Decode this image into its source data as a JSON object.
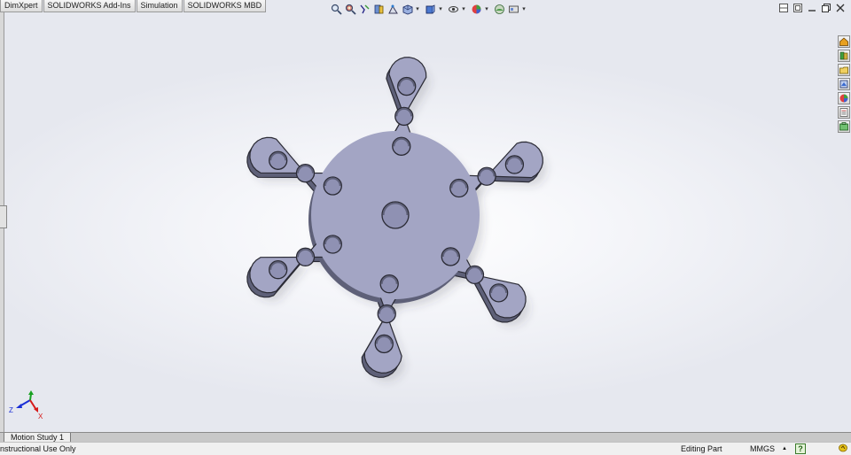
{
  "command_tabs": [
    "DimXpert",
    "SOLIDWORKS Add-Ins",
    "Simulation",
    "SOLIDWORKS MBD"
  ],
  "heads_up_toolbar": [
    {
      "icon": "zoom-to-fit-icon"
    },
    {
      "icon": "zoom-to-area-icon"
    },
    {
      "icon": "previous-view-icon"
    },
    {
      "icon": "section-view-icon"
    },
    {
      "icon": "dynamic-annotation-icon"
    },
    {
      "icon": "view-orientation-icon"
    },
    {
      "icon": "display-style-icon"
    },
    {
      "icon": "hide-show-items-icon"
    },
    {
      "icon": "edit-appearance-icon"
    },
    {
      "icon": "apply-scene-icon"
    },
    {
      "icon": "view-settings-icon"
    }
  ],
  "window_controls": [
    "tile-icon",
    "restore-pane-icon",
    "minimize-icon",
    "restore-icon",
    "close-icon"
  ],
  "task_pane": [
    "solidworks-resources-icon",
    "design-library-icon",
    "file-explorer-icon",
    "view-palette-icon",
    "appearances-icon",
    "custom-properties-icon",
    "toolbox-icon"
  ],
  "colors": {
    "part_face": "#a3a5c4",
    "part_edge": "#2a2a34",
    "part_side": "#5e6078",
    "hole": "#8f91b3"
  },
  "model": {
    "type": "six-arm star plate",
    "arms": 6,
    "holes_per_arm": 3,
    "center_holes": 1
  },
  "triad": {
    "labels": [
      "Z",
      "X"
    ]
  },
  "motion_tab": {
    "label": "Motion Study 1"
  },
  "status": {
    "left": "nstructional Use Only",
    "editing": "Editing Part",
    "units": "MMGS",
    "units_caret": "▲",
    "help": "?"
  }
}
